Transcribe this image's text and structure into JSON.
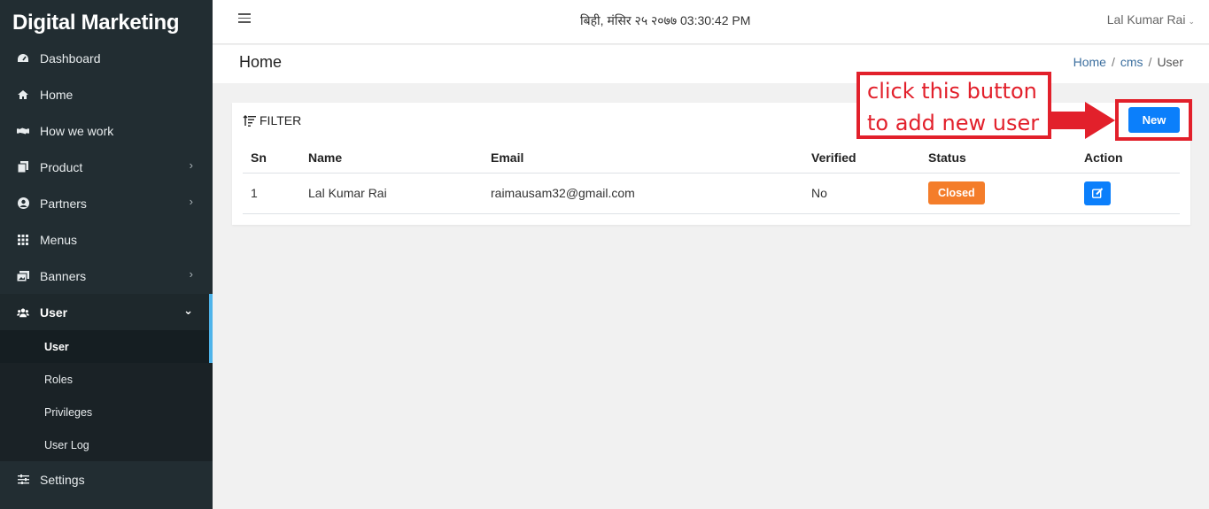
{
  "app": {
    "brand": "Digital Marketing"
  },
  "sidebar": {
    "items": [
      {
        "label": "Dashboard",
        "icon": "dashboard-icon"
      },
      {
        "label": "Home",
        "icon": "home-icon"
      },
      {
        "label": "How we work",
        "icon": "handshake-icon"
      },
      {
        "label": "Product",
        "icon": "copy-icon",
        "has_children": true
      },
      {
        "label": "Partners",
        "icon": "user-circle-icon",
        "has_children": true
      },
      {
        "label": "Menus",
        "icon": "grid-icon"
      },
      {
        "label": "Banners",
        "icon": "images-icon",
        "has_children": true
      },
      {
        "label": "User",
        "icon": "users-icon",
        "expanded": true
      },
      {
        "label": "Settings",
        "icon": "sliders-icon"
      }
    ],
    "user_submenu": [
      "User",
      "Roles",
      "Privileges",
      "User Log"
    ],
    "active_subitem": "User"
  },
  "topbar": {
    "datetime": "बिही, मंसिर २५ २०७७ 03:30:42 PM",
    "user_name": "Lal Kumar Rai"
  },
  "page": {
    "title": "Home",
    "breadcrumb": [
      "Home",
      "cms",
      "User"
    ]
  },
  "card": {
    "filter_label": "FILTER",
    "new_button_label": "New",
    "table": {
      "headers": [
        "Sn",
        "Name",
        "Email",
        "Verified",
        "Status",
        "Action"
      ],
      "rows": [
        {
          "sn": "1",
          "name": "Lal Kumar Rai",
          "email": "raimausam32@gmail.com",
          "verified": "No",
          "status": "Closed"
        }
      ]
    }
  },
  "annotation": {
    "line1": "click this button",
    "line2": "to add new user"
  },
  "colors": {
    "sidebar_bg": "#222d32",
    "accent": "#4fb4ea",
    "primary_button": "#0b7ffb",
    "status_closed": "#f47d2a",
    "annotation_red": "#e2202b"
  }
}
